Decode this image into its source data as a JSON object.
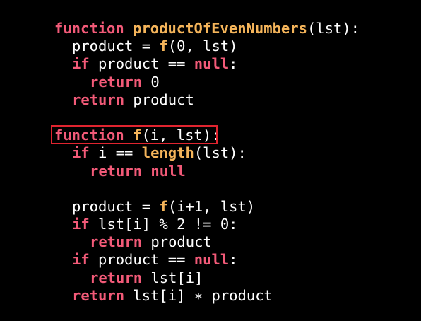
{
  "lines": [
    {
      "indent": 0,
      "tokens": [
        {
          "t": "function",
          "c": "kw"
        },
        {
          "t": " ",
          "c": "plain"
        },
        {
          "t": "productOfEvenNumbers",
          "c": "fn"
        },
        {
          "t": "(lst):",
          "c": "plain"
        }
      ]
    },
    {
      "indent": 1,
      "tokens": [
        {
          "t": "product = ",
          "c": "plain"
        },
        {
          "t": "f",
          "c": "fn"
        },
        {
          "t": "(0, lst)",
          "c": "plain"
        }
      ]
    },
    {
      "indent": 1,
      "tokens": [
        {
          "t": "if",
          "c": "kw"
        },
        {
          "t": " product == ",
          "c": "plain"
        },
        {
          "t": "null",
          "c": "kw"
        },
        {
          "t": ":",
          "c": "plain"
        }
      ]
    },
    {
      "indent": 2,
      "tokens": [
        {
          "t": "return",
          "c": "kw"
        },
        {
          "t": " 0",
          "c": "plain"
        }
      ]
    },
    {
      "indent": 1,
      "tokens": [
        {
          "t": "return",
          "c": "kw"
        },
        {
          "t": " product",
          "c": "plain"
        }
      ]
    },
    {
      "indent": 0,
      "tokens": []
    },
    {
      "indent": 0,
      "tokens": [
        {
          "t": "function",
          "c": "kw"
        },
        {
          "t": " ",
          "c": "plain"
        },
        {
          "t": "f",
          "c": "fn"
        },
        {
          "t": "(i, lst):",
          "c": "plain"
        }
      ]
    },
    {
      "indent": 1,
      "tokens": [
        {
          "t": "if",
          "c": "kw"
        },
        {
          "t": " i == ",
          "c": "plain"
        },
        {
          "t": "length",
          "c": "fn"
        },
        {
          "t": "(lst):",
          "c": "plain"
        }
      ]
    },
    {
      "indent": 2,
      "tokens": [
        {
          "t": "return",
          "c": "kw"
        },
        {
          "t": " ",
          "c": "plain"
        },
        {
          "t": "null",
          "c": "kw"
        }
      ]
    },
    {
      "indent": 0,
      "tokens": []
    },
    {
      "indent": 1,
      "tokens": [
        {
          "t": "product = ",
          "c": "plain"
        },
        {
          "t": "f",
          "c": "fn"
        },
        {
          "t": "(i+1, lst)",
          "c": "plain"
        }
      ]
    },
    {
      "indent": 1,
      "tokens": [
        {
          "t": "if",
          "c": "kw"
        },
        {
          "t": " lst[i] % 2 != 0:",
          "c": "plain"
        }
      ]
    },
    {
      "indent": 2,
      "tokens": [
        {
          "t": "return",
          "c": "kw"
        },
        {
          "t": " product",
          "c": "plain"
        }
      ]
    },
    {
      "indent": 1,
      "tokens": [
        {
          "t": "if",
          "c": "kw"
        },
        {
          "t": " product == ",
          "c": "plain"
        },
        {
          "t": "null",
          "c": "kw"
        },
        {
          "t": ":",
          "c": "plain"
        }
      ]
    },
    {
      "indent": 2,
      "tokens": [
        {
          "t": "return",
          "c": "kw"
        },
        {
          "t": " lst[i]",
          "c": "plain"
        }
      ]
    },
    {
      "indent": 1,
      "tokens": [
        {
          "t": "return",
          "c": "kw"
        },
        {
          "t": " lst[i] ",
          "c": "plain"
        },
        {
          "t": "∗",
          "c": "plain"
        },
        {
          "t": " product",
          "c": "plain"
        }
      ]
    }
  ],
  "highlight_line": 6,
  "colors": {
    "background": "#000000",
    "keyword": "#f25a78",
    "function_name": "#f4b45a",
    "text": "#ffffff",
    "highlight_border": "#e0242f"
  }
}
